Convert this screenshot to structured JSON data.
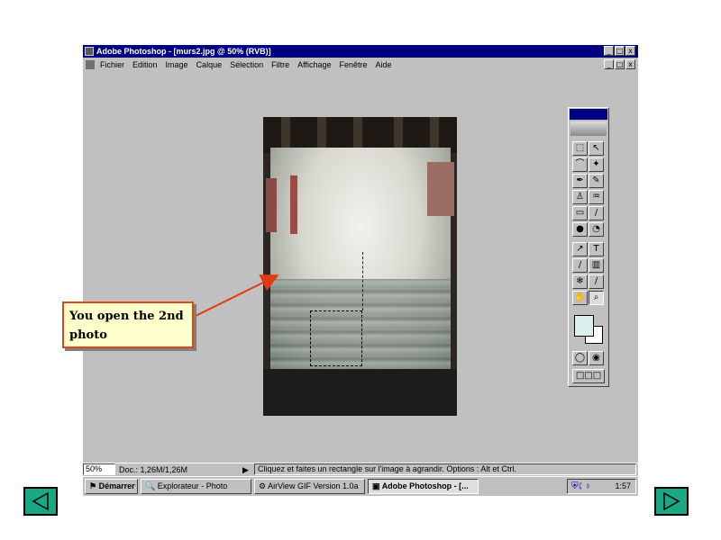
{
  "window": {
    "title": "Adobe Photoshop - [murs2.jpg @ 50% (RVB)]",
    "controls": [
      "_",
      "□",
      "x"
    ]
  },
  "menubar": {
    "items": [
      "Fichier",
      "Edition",
      "Image",
      "Calque",
      "Sélection",
      "Filtre",
      "Affichage",
      "Fenêtre",
      "Aide"
    ]
  },
  "document": {
    "image_subject": "wall-with-fresco-fragments"
  },
  "toolbox": {
    "tool_icons": [
      "marquee-icon",
      "move-icon",
      "lasso-icon",
      "magic-wand-icon",
      "airbrush-icon",
      "paintbrush-icon",
      "rubber-stamp-icon",
      "history-brush-icon",
      "eraser-icon",
      "pencil-icon",
      "blur-icon",
      "dodge-icon",
      "pen-icon",
      "type-icon",
      "measure-icon",
      "gradient-icon",
      "paint-bucket-icon",
      "eyedropper-icon",
      "hand-icon",
      "zoom-icon"
    ],
    "foreground_color": "#ddeeee",
    "background_color": "#ffffff"
  },
  "statusbar": {
    "zoom": "50%",
    "doc_size": "Doc.: 1,26M/1,26M",
    "hint": "Cliquez et faites un rectangle sur l'image à agrandir. Options : Alt et Ctrl."
  },
  "taskbar": {
    "start": "Démarrer",
    "tasks": [
      "Explorateur - Photo",
      "AirView GIF Version 1.0a",
      "Adobe Photoshop - [..."
    ],
    "active_task": "Adobe Photoshop - [...",
    "clock": "1:57"
  },
  "callout": {
    "text": "You open the 2nd photo"
  },
  "navigation": {
    "previous_icon": "triangle-left-icon",
    "next_icon": "triangle-right-icon",
    "color": "#1aa884"
  }
}
